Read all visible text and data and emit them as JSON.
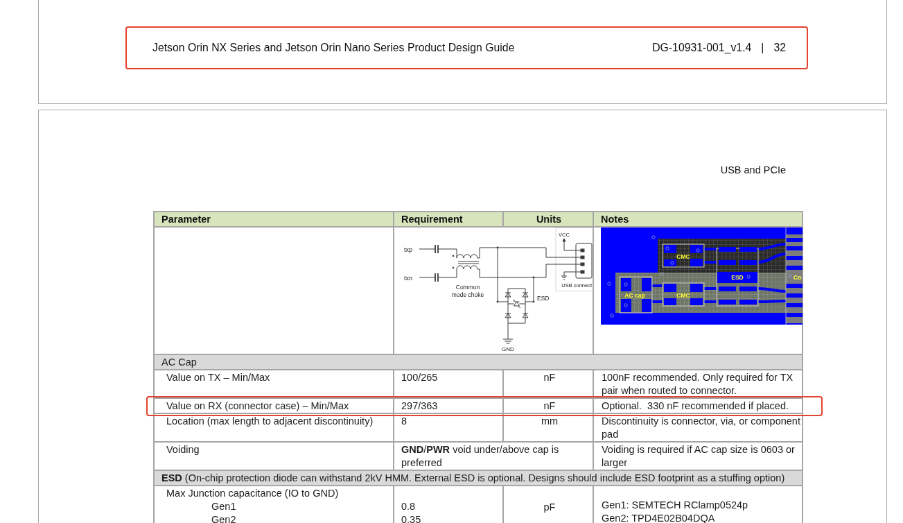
{
  "doc_header": {
    "title": "Jetson Orin NX Series and Jetson Orin Nano Series Product Design Guide",
    "doc_id": "DG-10931-001_v1.4",
    "separator": "|",
    "page": "32",
    "highlighted": true
  },
  "chapter_title": "USB and PCIe",
  "table": {
    "columns": [
      "Parameter",
      "Requirement",
      "Units",
      "Notes"
    ],
    "figure_row": {
      "schematic": {
        "nets": [
          "txp",
          "txn"
        ],
        "choke_label_lines": [
          "Common",
          "mode choke"
        ],
        "esd_label": "ESD",
        "ground_label": "GND",
        "supply_label": "VCC",
        "connector_label": "USB connect"
      },
      "layout": {
        "cmc_top": "CMC",
        "esd": "ESD",
        "ac_cap": "AC cap",
        "cmc_bottom": "CMC",
        "connector": "Co"
      }
    },
    "rows": [
      {
        "kind": "section",
        "title": "AC Cap",
        "highlighted": false
      },
      {
        "kind": "param",
        "parameter": "Value on TX – Min/Max",
        "requirement": "100/265",
        "units": "nF",
        "notes": "100nF recommended. Only required for TX pair when routed to connector.",
        "highlighted": false
      },
      {
        "kind": "param",
        "parameter": "Value on RX (connector case) – Min/Max",
        "requirement": "297/363",
        "units": "nF",
        "notes": "Optional.  330 nF recommended if placed.",
        "highlighted": true
      },
      {
        "kind": "param",
        "parameter": "Location (max length to adjacent discontinuity)",
        "requirement": "8",
        "units": "mm",
        "notes": "Discontinuity is connector, via, or component pad",
        "highlighted": false
      },
      {
        "kind": "param",
        "parameter": "Voiding",
        "requirement": "**GND**/**PWR** void under/above cap is preferred",
        "notes": "Voiding is required if AC cap size is 0603 or larger",
        "highlighted": false
      },
      {
        "kind": "section",
        "title": "**ESD** (On-chip protection diode can withstand 2kV HMM. External ESD is optional. Designs should include ESD footprint as a stuffing option)",
        "highlighted": false
      },
      {
        "kind": "param_list",
        "parameter": "Max Junction capacitance (IO to GND)",
        "items": [
          {
            "label": "Gen1",
            "requirement": "0.8"
          },
          {
            "label": "Gen2",
            "requirement": "0.35"
          }
        ],
        "units": "pF",
        "notes": [
          "Gen1: SEMTECH RClamp0524p",
          "Gen2: TPD4E02B04DQA"
        ],
        "highlighted": false
      }
    ]
  }
}
